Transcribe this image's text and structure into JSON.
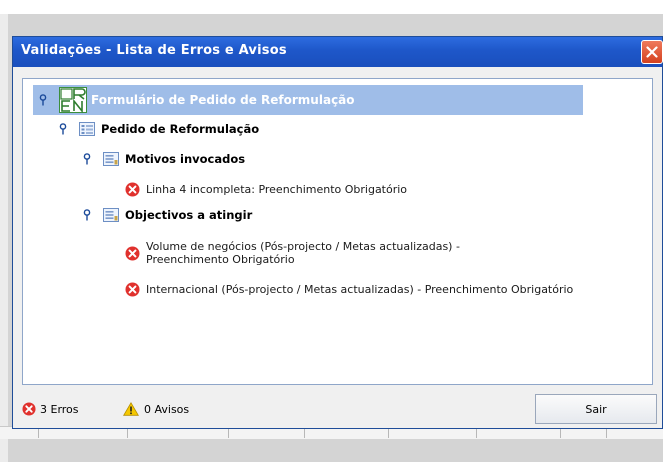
{
  "dialog": {
    "title": "Validações - Lista de Erros e Avisos"
  },
  "tree": {
    "root": {
      "label": "Formulário de Pedido de Reformulação",
      "logo": "ORE-logo"
    },
    "section": {
      "label": "Pedido de Reformulação"
    },
    "groups": [
      {
        "label": "Motivos invocados",
        "errors": [
          {
            "line1": "Linha 4 incompleta: Preenchimento Obrigatório",
            "line2": ""
          }
        ]
      },
      {
        "label": "Objectivos a atingir",
        "errors": [
          {
            "line1": "Volume de negócios (Pós-projecto / Metas actualizadas) -",
            "line2": "Preenchimento Obrigatório"
          },
          {
            "line1": "Internacional (Pós-projecto / Metas actualizadas) - Preenchimento Obrigatório",
            "line2": ""
          }
        ]
      }
    ]
  },
  "status": {
    "errors": "3 Erros",
    "warnings": "0 Avisos"
  },
  "buttons": {
    "exit": "Sair"
  },
  "icons": {
    "close": "close-icon",
    "pin": "pin-icon",
    "form": "form-icon",
    "list": "list-icon",
    "error": "error-icon",
    "warning": "warning-icon"
  },
  "colors": {
    "titlebar": "#1e57c9",
    "root_highlight": "#9fbde8",
    "error": "#e0312d",
    "warning": "#f5c800"
  }
}
